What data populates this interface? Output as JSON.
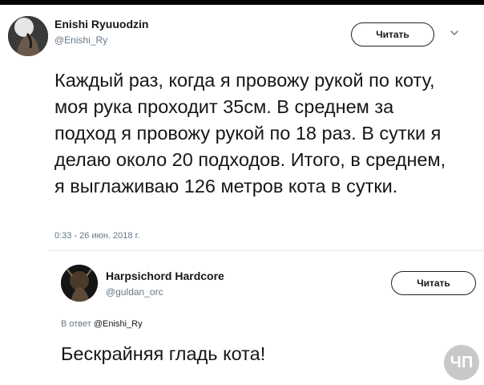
{
  "main_tweet": {
    "author_name": "Enishi Ryuuodzin",
    "author_handle": "@Enishi_Ry",
    "follow_label": "Читать",
    "text": "Каждый раз, когда я провожу рукой по коту, моя рука проходит 35см. В среднем за подход я провожу рукой по 18 раз. В сутки я делаю около 20 подходов. Итого, в среднем, я выглаживаю 126 метров кота в сутки.",
    "timestamp": "0:33 - 26 июн. 2018 г."
  },
  "reply_tweet": {
    "author_name": "Harpsichord Hardcore",
    "author_handle": "@guldan_orc",
    "follow_label": "Читать",
    "reply_prefix": "В ответ",
    "reply_to_handle": "@Enishi_Ry",
    "text": "Бескрайняя гладь кота!"
  },
  "watermark": {
    "text": "ЧП"
  },
  "icons": {
    "menu": "chevron-down-icon"
  },
  "colors": {
    "text": "#14171a",
    "muted": "#657786",
    "divider": "#e1e8ed"
  }
}
